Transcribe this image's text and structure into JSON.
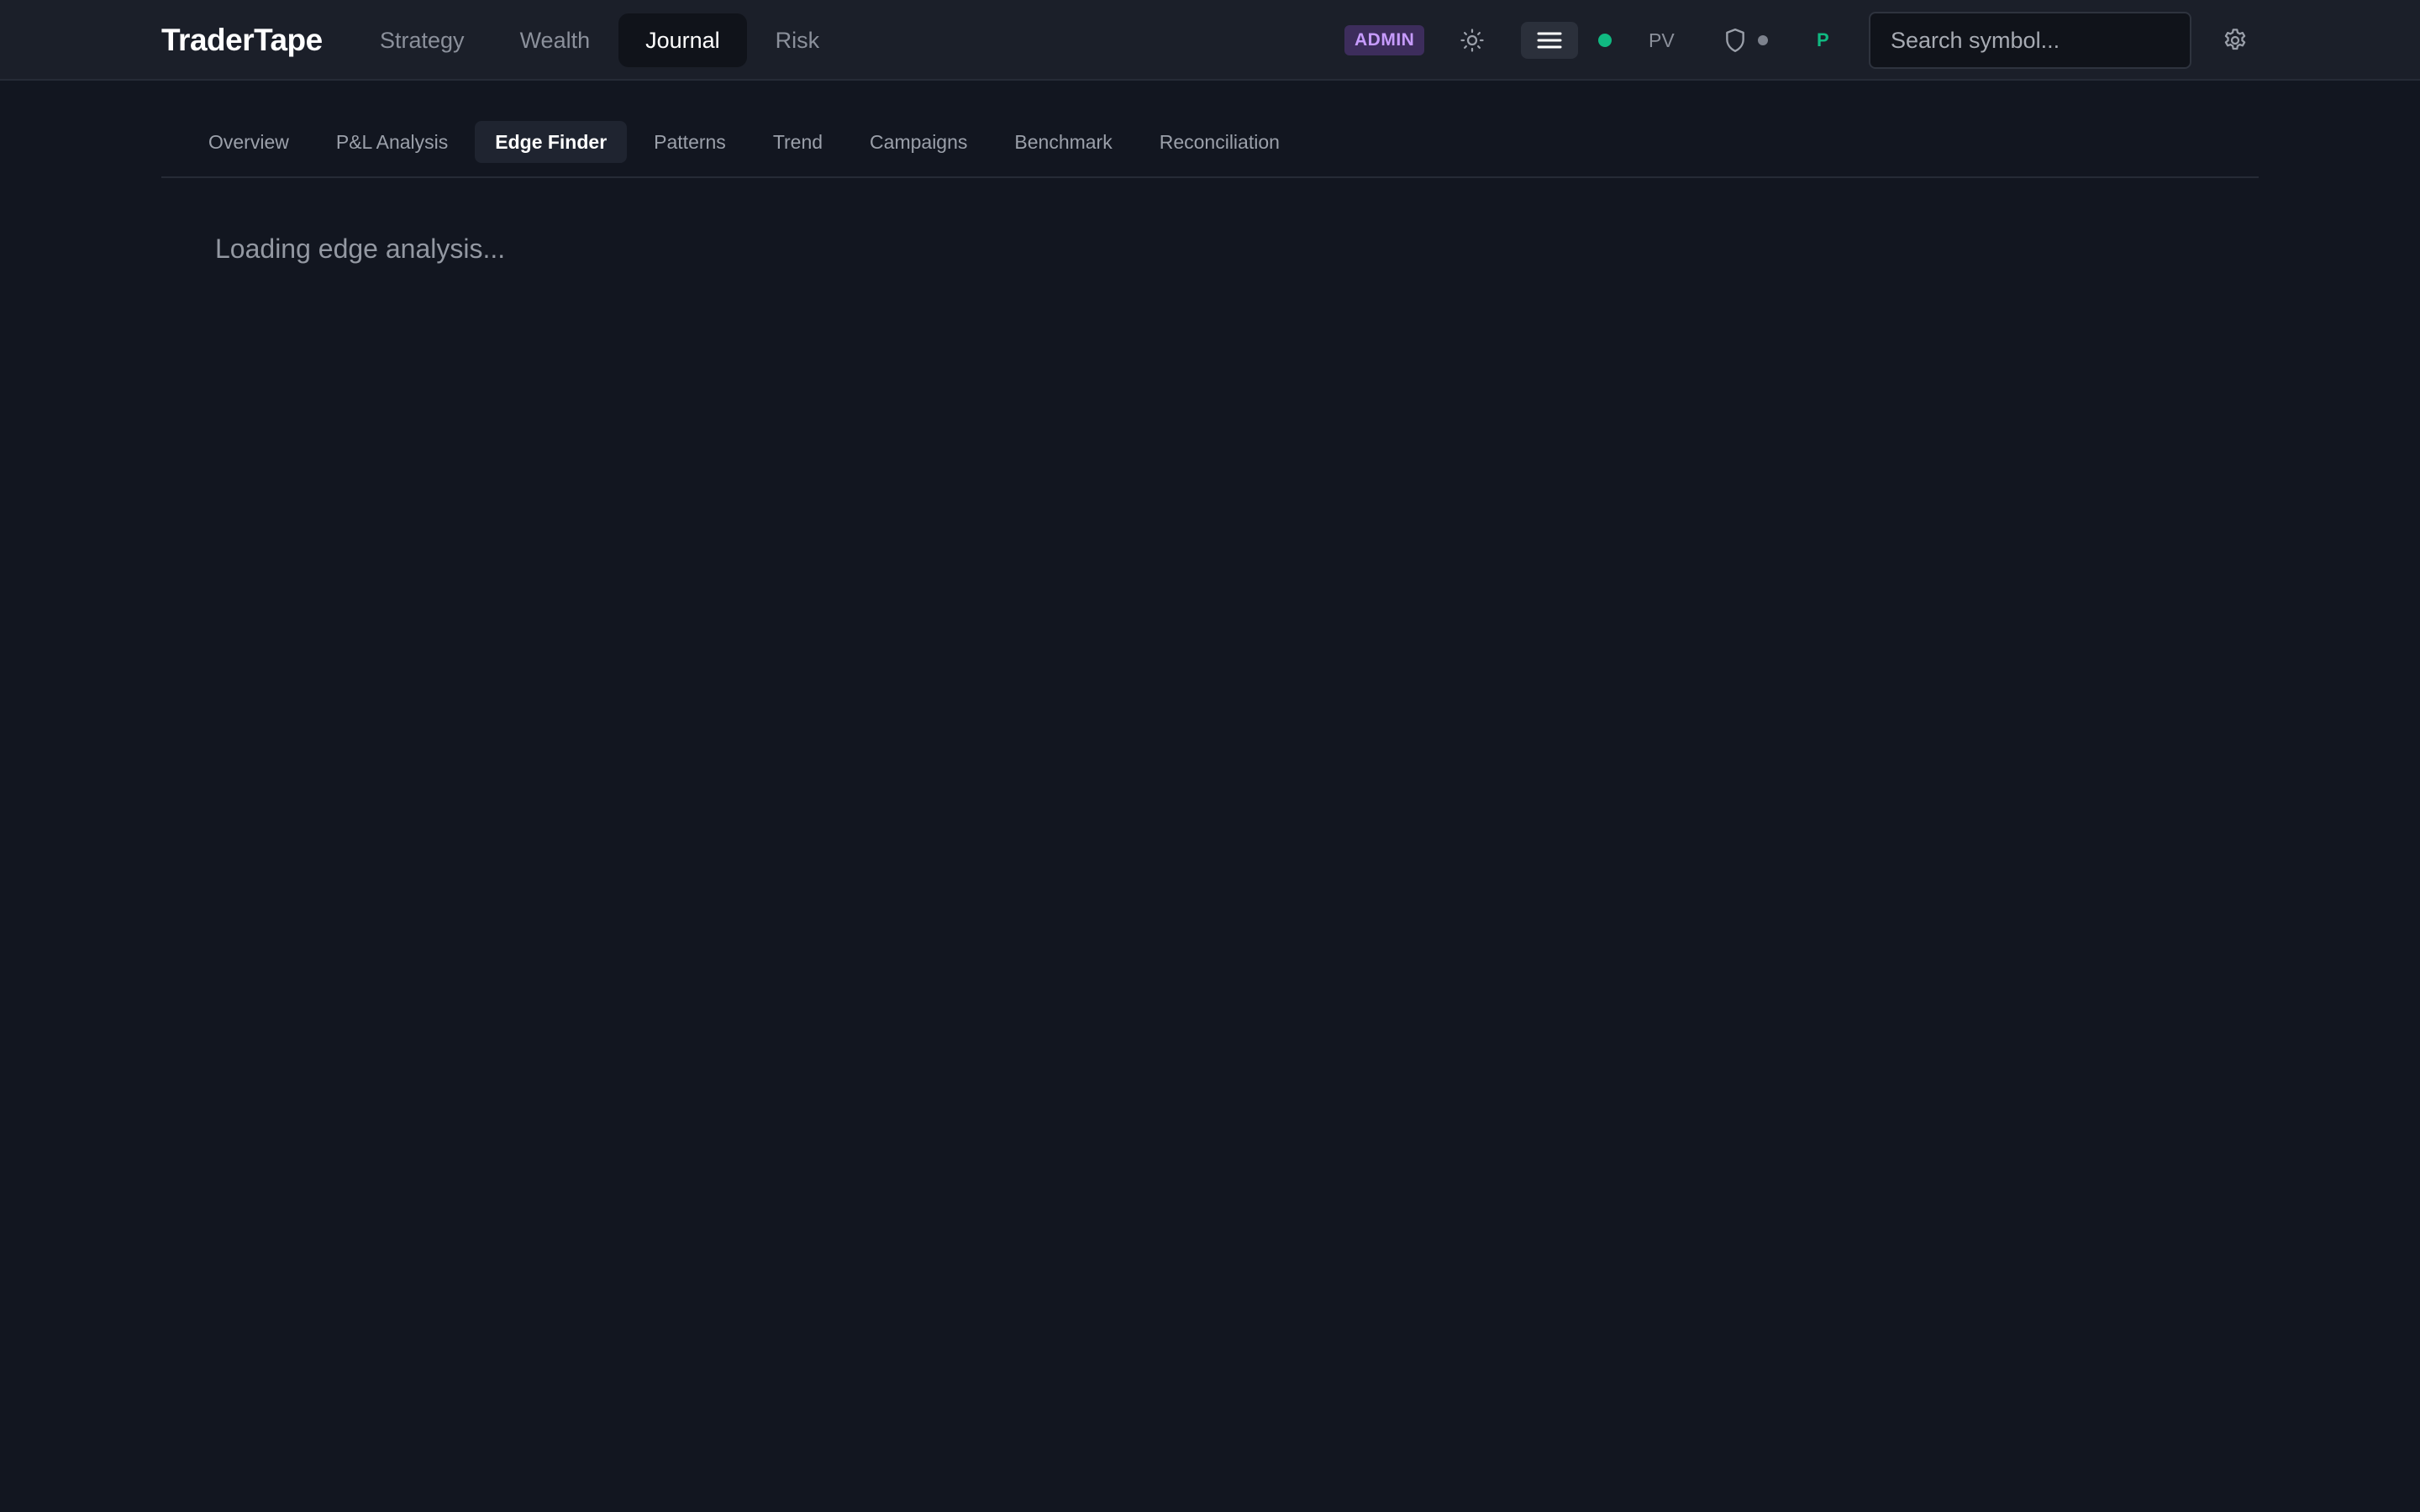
{
  "app": {
    "brand": "TraderTape"
  },
  "main_nav": {
    "items": [
      {
        "label": "Strategy",
        "active": false
      },
      {
        "label": "Wealth",
        "active": false
      },
      {
        "label": "Journal",
        "active": true
      },
      {
        "label": "Risk",
        "active": false
      }
    ]
  },
  "header": {
    "admin_badge": "ADMIN",
    "theme_icon": "sun-icon",
    "menu_icon": "hamburger-menu-icon",
    "status_color": "#10b981",
    "pv_label": "PV",
    "shield_icon": "shield-icon",
    "p_label": "P",
    "search_placeholder": "Search symbol...",
    "settings_icon": "gear-icon"
  },
  "sub_nav": {
    "tabs": [
      {
        "label": "Overview",
        "active": false
      },
      {
        "label": "P&L Analysis",
        "active": false
      },
      {
        "label": "Edge Finder",
        "active": true
      },
      {
        "label": "Patterns",
        "active": false
      },
      {
        "label": "Trend",
        "active": false
      },
      {
        "label": "Campaigns",
        "active": false
      },
      {
        "label": "Benchmark",
        "active": false
      },
      {
        "label": "Reconciliation",
        "active": false
      }
    ]
  },
  "content": {
    "loading_message": "Loading edge analysis..."
  },
  "colors": {
    "background": "#121620",
    "topbar": "#1b1f29",
    "accent_green": "#10b981",
    "admin_purple": "#c79bff"
  }
}
